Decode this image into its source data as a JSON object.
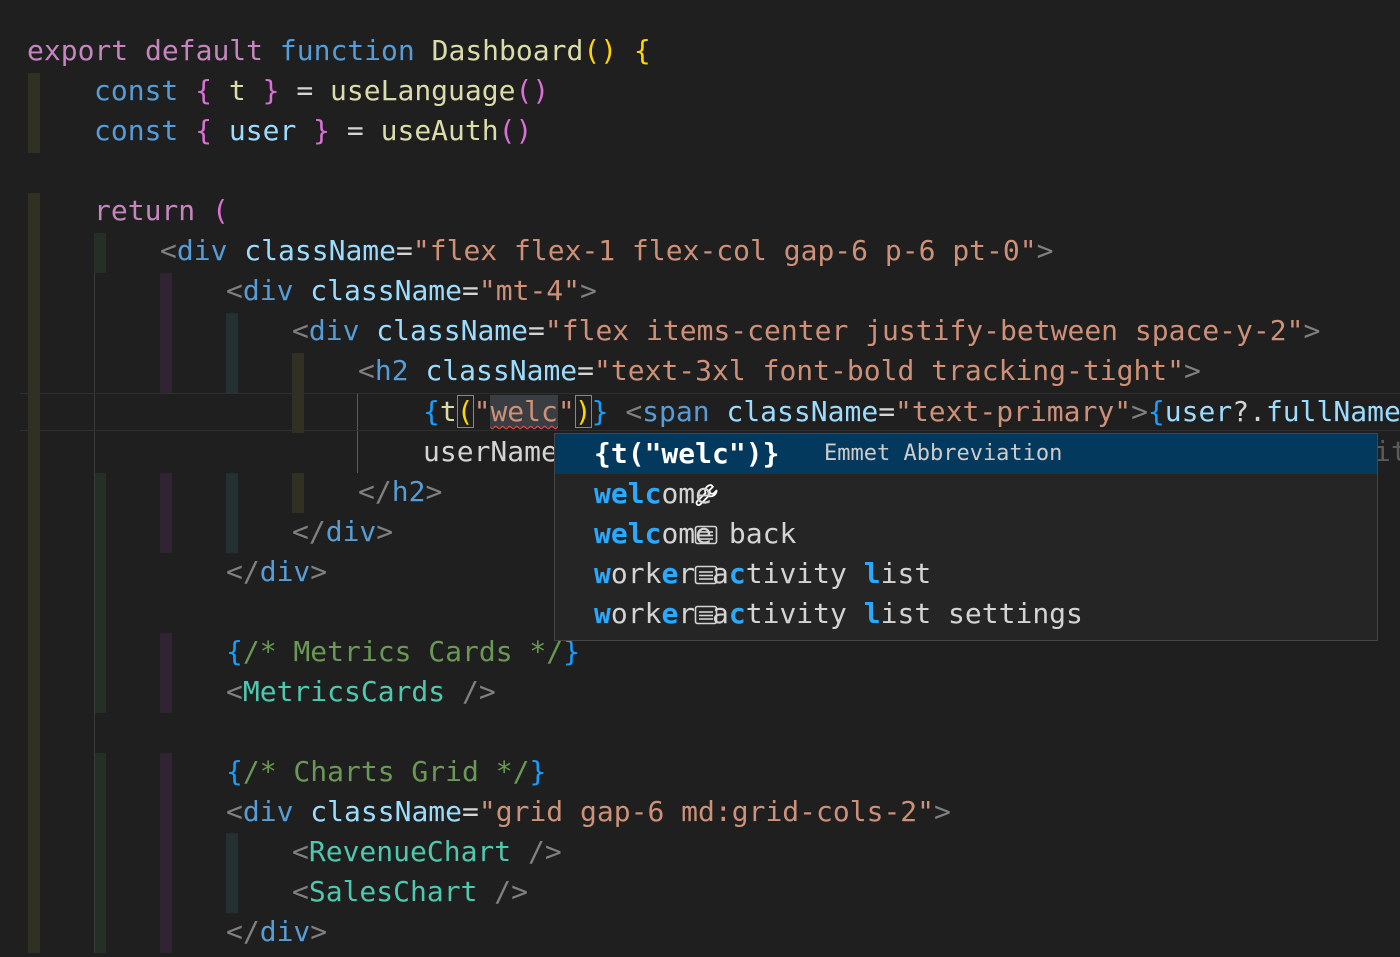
{
  "editor": {
    "lines": {
      "l1": {
        "kw_export": "export",
        "kw_default": "default",
        "kw_function": "function",
        "name": "Dashboard",
        "paren_open": "(",
        "paren_close": ")",
        "brace": "{"
      },
      "l2": {
        "kw": "const",
        "lb": "{",
        "var": "t",
        "rb": "}",
        "eq": "=",
        "call": "useLanguage",
        "po": "(",
        "pc": ")"
      },
      "l3": {
        "kw": "const",
        "lb": "{",
        "var": "user",
        "rb": "}",
        "eq": "=",
        "call": "useAuth",
        "po": "(",
        "pc": ")"
      },
      "l5": {
        "kw": "return",
        "paren": "("
      },
      "l6": {
        "lt": "<",
        "tag": "div",
        "attr": "className",
        "eq": "=",
        "val": "\"flex flex-1 flex-col gap-6 p-6 pt-0\"",
        "gt": ">"
      },
      "l7": {
        "lt": "<",
        "tag": "div",
        "attr": "className",
        "eq": "=",
        "val": "\"mt-4\"",
        "gt": ">"
      },
      "l8": {
        "lt": "<",
        "tag": "div",
        "attr": "className",
        "eq": "=",
        "val": "\"flex items-center justify-between space-y-2\"",
        "gt": ">"
      },
      "l9": {
        "lt": "<",
        "tag": "h2",
        "attr": "className",
        "eq": "=",
        "val": "\"text-3xl font-bold tracking-tight\"",
        "gt": ">"
      },
      "l10": {
        "lb": "{",
        "fn": "t",
        "po": "(",
        "q1": "\"",
        "typed": "welc",
        "q2": "\"",
        "pc": ")",
        "rb": "}",
        "lt": "<",
        "tag": "span",
        "attr": "className",
        "eq": "=",
        "val": "\"text-primary\"",
        "gt": ">",
        "lb2": "{",
        "obj": "user",
        "opt": "?.",
        "prop": "fullName"
      },
      "l11": {
        "text": "userName",
        "tail": "it"
      },
      "l12": {
        "lt": "</",
        "tag": "h2",
        "gt": ">"
      },
      "l13": {
        "lt": "</",
        "tag": "div",
        "gt": ">"
      },
      "l14": {
        "lt": "</",
        "tag": "div",
        "gt": ">"
      },
      "l16": {
        "lb": "{",
        "comment": "/* Metrics Cards */",
        "rb": "}"
      },
      "l17": {
        "lt": "<",
        "comp": "MetricsCards",
        "end": " />"
      },
      "l19": {
        "lb": "{",
        "comment": "/* Charts Grid */",
        "rb": "}"
      },
      "l20": {
        "lt": "<",
        "tag": "div",
        "attr": "className",
        "eq": "=",
        "val": "\"grid gap-6 md:grid-cols-2\"",
        "gt": ">"
      },
      "l21": {
        "lt": "<",
        "comp": "RevenueChart",
        "end": " />"
      },
      "l22": {
        "lt": "<",
        "comp": "SalesChart",
        "end": " />"
      },
      "l23": {
        "lt": "</",
        "tag": "div",
        "gt": ">"
      }
    }
  },
  "suggest": {
    "items": [
      {
        "icon": "wrench-icon",
        "label": "{t(\"welc\")}",
        "detail": "Emmet Abbreviation",
        "selected": true
      },
      {
        "icon": "text-icon",
        "match": "welc",
        "rest": "ome"
      },
      {
        "icon": "text-icon",
        "match": "welc",
        "rest": "ome back"
      },
      {
        "icon": "text-icon",
        "label": "worker activity list"
      },
      {
        "icon": "text-icon",
        "label": "worker activity list settings"
      }
    ]
  },
  "colors": {
    "background": "#1f1f1f",
    "keyword_purple": "#c586c0",
    "keyword_blue": "#569cd6",
    "function": "#dcdcaa",
    "string": "#ce9178",
    "component": "#4ec9b0",
    "comment": "#6a9955",
    "match_highlight": "#2aaaff",
    "suggest_selected": "#04395e"
  }
}
